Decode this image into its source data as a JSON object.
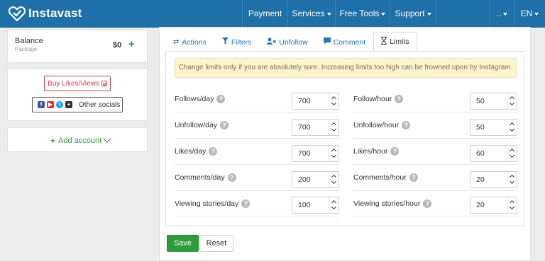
{
  "brand": {
    "name": "Instavast"
  },
  "nav": {
    "items": [
      {
        "label": "Payment",
        "dropdown": false
      },
      {
        "label": "Services",
        "dropdown": true
      },
      {
        "label": "Free Tools",
        "dropdown": true
      },
      {
        "label": "Support",
        "dropdown": true
      }
    ],
    "user_menu": "..",
    "language": "EN"
  },
  "sidebar": {
    "balance": {
      "label": "Balance",
      "sub": "Package",
      "amount": "$0",
      "add": "+"
    },
    "buy_button": "Buy Likes/Views",
    "socials_button": "Other socials",
    "add_account": "Add account"
  },
  "tabs": [
    {
      "label": "Actions",
      "icon": "swap-icon",
      "active": false
    },
    {
      "label": "Filters",
      "icon": "filter-icon",
      "active": false
    },
    {
      "label": "Unfollow",
      "icon": "user-x-icon",
      "active": false
    },
    {
      "label": "Comment",
      "icon": "comment-icon",
      "active": false
    },
    {
      "label": "Limits",
      "icon": "hourglass-icon",
      "active": true
    }
  ],
  "warning": "Change limits only if you are absolutely sure. Increasing limits too high can be frowned upon by Instagram.",
  "limits": {
    "left": [
      {
        "label": "Follows/day",
        "value": "700"
      },
      {
        "label": "Unfollow/day",
        "value": "700"
      },
      {
        "label": "Likes/day",
        "value": "700"
      },
      {
        "label": "Comments/day",
        "value": "200"
      },
      {
        "label": "Viewing stories/day",
        "value": "100"
      }
    ],
    "right": [
      {
        "label": "Follow/hour",
        "value": "50"
      },
      {
        "label": "Unfollow/hour",
        "value": "50"
      },
      {
        "label": "Likes/hour",
        "value": "60"
      },
      {
        "label": "Comments/hour",
        "value": "20"
      },
      {
        "label": "Viewing stories/hour",
        "value": "20"
      }
    ],
    "help_glyph": "?"
  },
  "actions": {
    "save": "Save",
    "reset": "Reset"
  },
  "colors": {
    "navbar": "#1f6fa8",
    "success": "#2e9b3a",
    "link": "#2a74b5",
    "warning_bg": "#fcf4d2",
    "danger": "#c7444a"
  }
}
